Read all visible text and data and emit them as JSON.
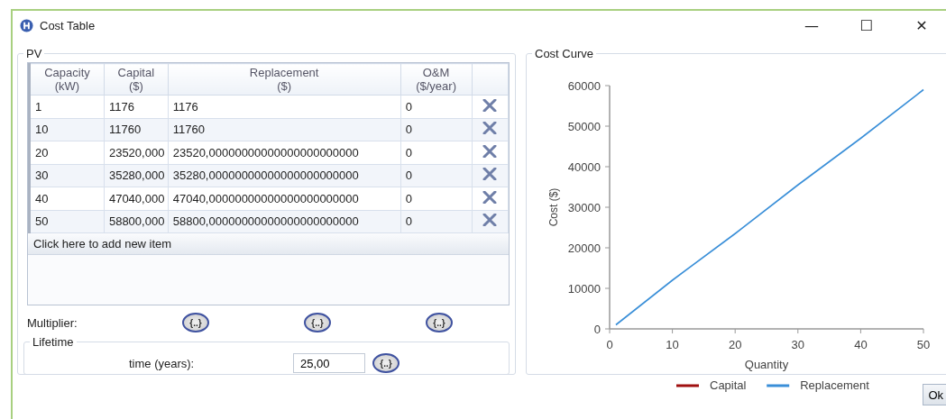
{
  "window": {
    "title": "Cost Table",
    "controls": [
      "—",
      "☐",
      "✕"
    ]
  },
  "pv_group": {
    "title": "PV",
    "table": {
      "columns": [
        {
          "line1": "Capacity",
          "line2": "(kW)"
        },
        {
          "line1": "Capital",
          "line2": "($)"
        },
        {
          "line1": "Replacement",
          "line2": "($)"
        },
        {
          "line1": "O&M",
          "line2": "($/year)"
        }
      ],
      "rows": [
        {
          "cells": [
            "1",
            "1176",
            "1176",
            "0"
          ]
        },
        {
          "cells": [
            "10",
            "11760",
            "11760",
            "0"
          ]
        },
        {
          "cells": [
            "20",
            "23520,000",
            "23520,00000000000000000000000",
            "0"
          ]
        },
        {
          "cells": [
            "30",
            "35280,000",
            "35280,00000000000000000000000",
            "0"
          ]
        },
        {
          "cells": [
            "40",
            "47040,000",
            "47040,00000000000000000000000",
            "0"
          ]
        },
        {
          "cells": [
            "50",
            "58800,000",
            "58800,00000000000000000000000",
            "0"
          ]
        }
      ],
      "add_row": "Click here to add new item"
    },
    "multiplier": {
      "label": "Multiplier:",
      "buttons": [
        "{..}",
        "{..}",
        "{..}"
      ]
    },
    "lifetime": {
      "title": "Lifetime",
      "label": "time (years):",
      "value": "25,00",
      "button": "{..}"
    }
  },
  "cost_curve": {
    "title": "Cost Curve",
    "chart_data": {
      "type": "line",
      "xlabel": "Quantity",
      "ylabel": "Cost ($)",
      "x": [
        1,
        10,
        20,
        30,
        40,
        50
      ],
      "series": [
        {
          "name": "Capital",
          "color": "#a01010",
          "values": [
            null,
            null,
            null,
            null,
            null,
            null
          ]
        },
        {
          "name": "Replacement",
          "color": "#3a8fd8",
          "values": [
            1000,
            12000,
            23500,
            35500,
            47000,
            59000
          ]
        }
      ],
      "legend": true,
      "xlim": [
        0,
        50
      ],
      "ylim": [
        0,
        60000
      ],
      "xticks": [
        {
          "value": 0,
          "label": "0"
        },
        {
          "value": 10,
          "label": "10"
        },
        {
          "value": 20,
          "label": "20"
        },
        {
          "value": 30,
          "label": "30"
        },
        {
          "value": 40,
          "label": "40"
        },
        {
          "value": 50,
          "label": "50"
        }
      ],
      "yticks": [
        {
          "value": 0,
          "label": "0"
        },
        {
          "value": 10000,
          "label": "10000"
        },
        {
          "value": 20000,
          "label": "20000"
        },
        {
          "value": 30000,
          "label": "30000"
        },
        {
          "value": 40000,
          "label": "40000"
        },
        {
          "value": 50000,
          "label": "50000"
        },
        {
          "value": 60000,
          "label": "60000"
        }
      ]
    }
  },
  "ok_button": "Ok"
}
